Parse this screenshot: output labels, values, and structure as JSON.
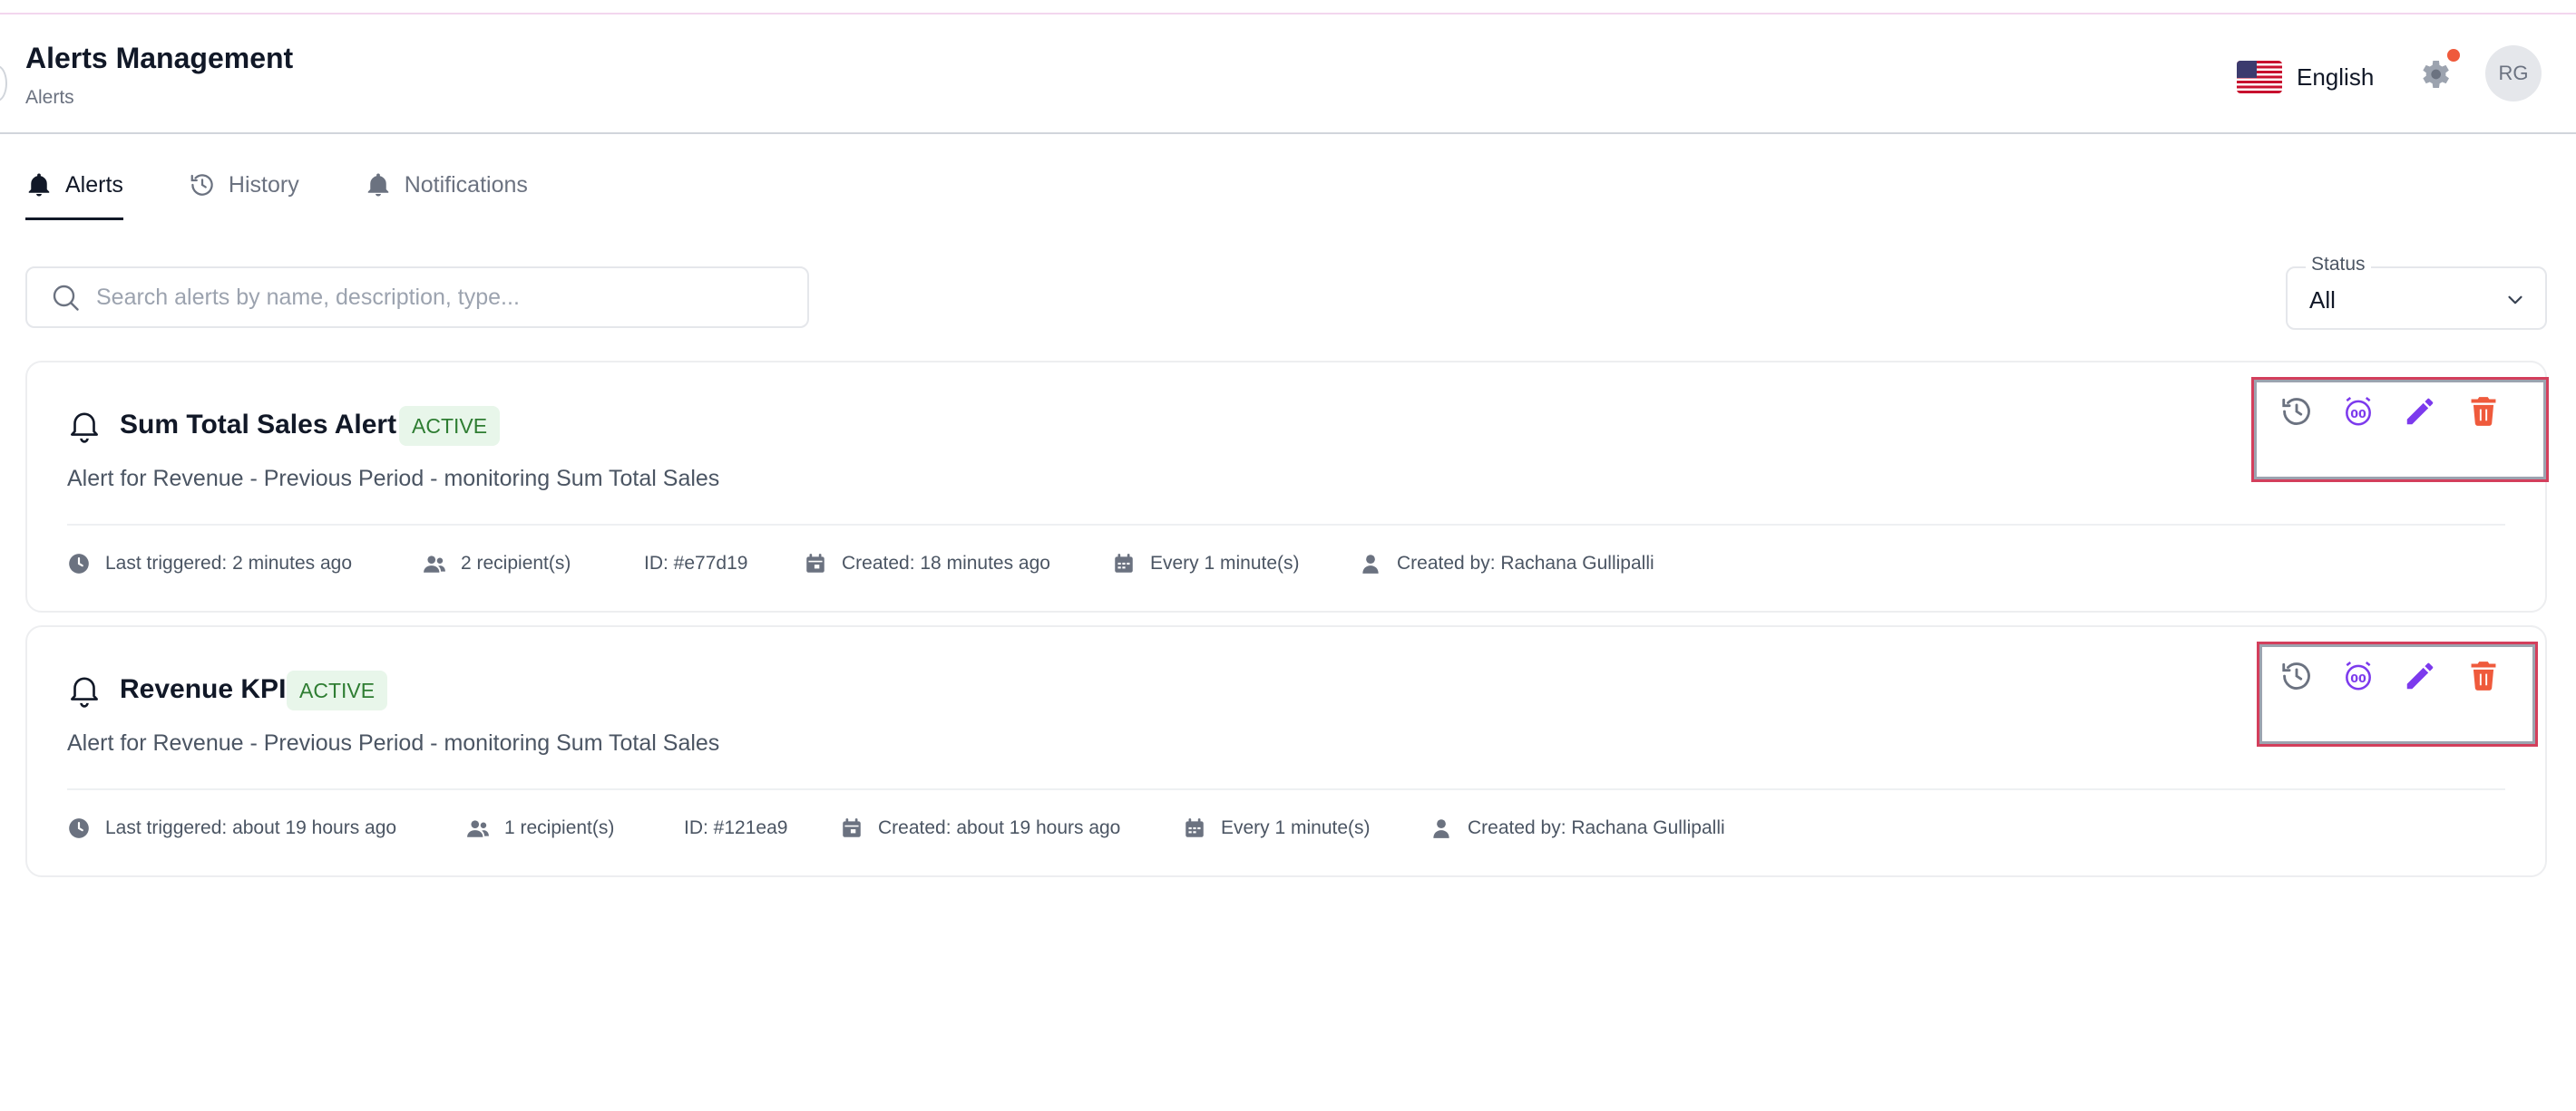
{
  "header": {
    "title": "Alerts Management",
    "breadcrumb": "Alerts",
    "language": "English",
    "avatar_initials": "RG",
    "flag_icon": "us-flag-icon",
    "settings_icon": "gear-icon"
  },
  "tabs": [
    {
      "label": "Alerts",
      "icon": "bell-filled-icon",
      "active": true
    },
    {
      "label": "History",
      "icon": "history-icon",
      "active": false
    },
    {
      "label": "Notifications",
      "icon": "bell-icon",
      "active": false
    }
  ],
  "search": {
    "placeholder": "Search alerts by name, description, type..."
  },
  "filter": {
    "label": "Status",
    "value": "All"
  },
  "alerts": [
    {
      "name": "Sum Total Sales Alert",
      "status": "ACTIVE",
      "description": "Alert for Revenue - Previous Period - monitoring Sum Total Sales",
      "last_triggered": "Last triggered: 2 minutes ago",
      "recipients": "2 recipient(s)",
      "id": "ID: #e77d19",
      "created": "Created: 18 minutes ago",
      "frequency": "Every 1 minute(s)",
      "created_by": "Created by: Rachana Gullipalli"
    },
    {
      "name": "Revenue KPI",
      "status": "ACTIVE",
      "description": "Alert for Revenue - Previous Period - monitoring Sum Total Sales",
      "last_triggered": "Last triggered: about 19 hours ago",
      "recipients": "1 recipient(s)",
      "id": "ID: #121ea9",
      "created": "Created: about 19 hours ago",
      "frequency": "Every 1 minute(s)",
      "created_by": "Created by: Rachana Gullipalli"
    }
  ],
  "colors": {
    "active_badge_bg": "#e8f6ea",
    "active_badge_text": "#2e7d32",
    "snooze_icon": "#7c3aed",
    "edit_icon": "#7c3aed",
    "delete_icon": "#ef5a3c",
    "highlight_box": "#d33f5c"
  }
}
